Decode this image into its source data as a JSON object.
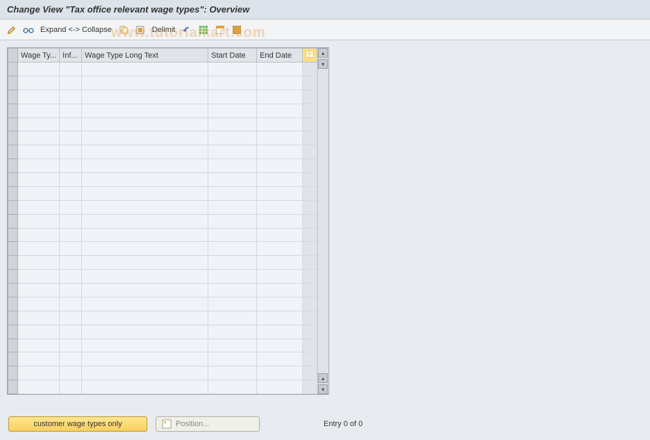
{
  "title": "Change View \"Tax office relevant wage types\": Overview",
  "toolbar": {
    "expand_collapse": "Expand <-> Collapse",
    "delimit": "Delimit"
  },
  "table": {
    "headers": {
      "wage_ty": "Wage Ty...",
      "inf": "Inf...",
      "long_text": "Wage Type Long Text",
      "start": "Start Date",
      "end": "End Date"
    },
    "rows": [
      {
        "wage_ty": "",
        "inf": "",
        "long_text": "",
        "start": "",
        "end": ""
      },
      {
        "wage_ty": "",
        "inf": "",
        "long_text": "",
        "start": "",
        "end": ""
      },
      {
        "wage_ty": "",
        "inf": "",
        "long_text": "",
        "start": "",
        "end": ""
      },
      {
        "wage_ty": "",
        "inf": "",
        "long_text": "",
        "start": "",
        "end": ""
      },
      {
        "wage_ty": "",
        "inf": "",
        "long_text": "",
        "start": "",
        "end": ""
      },
      {
        "wage_ty": "",
        "inf": "",
        "long_text": "",
        "start": "",
        "end": ""
      },
      {
        "wage_ty": "",
        "inf": "",
        "long_text": "",
        "start": "",
        "end": ""
      },
      {
        "wage_ty": "",
        "inf": "",
        "long_text": "",
        "start": "",
        "end": ""
      },
      {
        "wage_ty": "",
        "inf": "",
        "long_text": "",
        "start": "",
        "end": ""
      },
      {
        "wage_ty": "",
        "inf": "",
        "long_text": "",
        "start": "",
        "end": ""
      },
      {
        "wage_ty": "",
        "inf": "",
        "long_text": "",
        "start": "",
        "end": ""
      },
      {
        "wage_ty": "",
        "inf": "",
        "long_text": "",
        "start": "",
        "end": ""
      },
      {
        "wage_ty": "",
        "inf": "",
        "long_text": "",
        "start": "",
        "end": ""
      },
      {
        "wage_ty": "",
        "inf": "",
        "long_text": "",
        "start": "",
        "end": ""
      },
      {
        "wage_ty": "",
        "inf": "",
        "long_text": "",
        "start": "",
        "end": ""
      },
      {
        "wage_ty": "",
        "inf": "",
        "long_text": "",
        "start": "",
        "end": ""
      },
      {
        "wage_ty": "",
        "inf": "",
        "long_text": "",
        "start": "",
        "end": ""
      },
      {
        "wage_ty": "",
        "inf": "",
        "long_text": "",
        "start": "",
        "end": ""
      },
      {
        "wage_ty": "",
        "inf": "",
        "long_text": "",
        "start": "",
        "end": ""
      },
      {
        "wage_ty": "",
        "inf": "",
        "long_text": "",
        "start": "",
        "end": ""
      },
      {
        "wage_ty": "",
        "inf": "",
        "long_text": "",
        "start": "",
        "end": ""
      },
      {
        "wage_ty": "",
        "inf": "",
        "long_text": "",
        "start": "",
        "end": ""
      },
      {
        "wage_ty": "",
        "inf": "",
        "long_text": "",
        "start": "",
        "end": ""
      },
      {
        "wage_ty": "",
        "inf": "",
        "long_text": "",
        "start": "",
        "end": ""
      }
    ]
  },
  "footer": {
    "customer_btn": "customer wage types only",
    "position_btn": "Position...",
    "entry": "Entry 0 of 0"
  },
  "watermark": "www.tutorialkart.com"
}
